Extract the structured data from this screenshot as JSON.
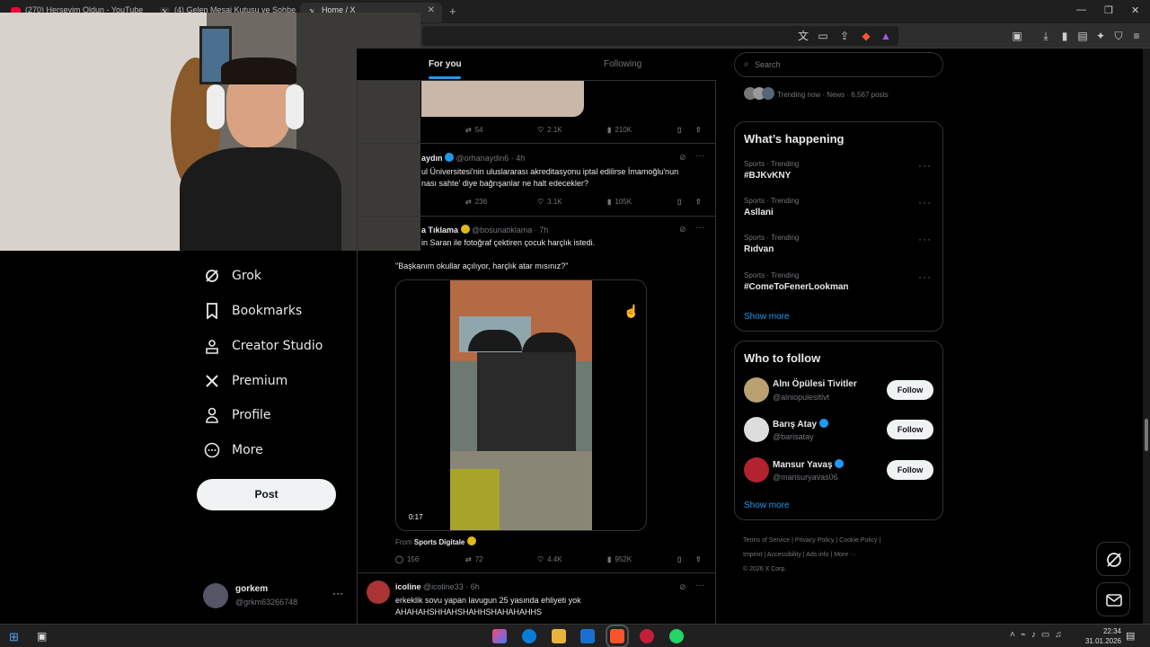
{
  "browser": {
    "tabs": [
      {
        "label": "(270) Herşeyim Oldun - YouTube",
        "active": false,
        "color": "#ff0033"
      },
      {
        "label": "(4) Gelen Mesaj Kutusu ve Sohbe",
        "active": false,
        "color": "#1d9bf0"
      },
      {
        "label": "Home / X",
        "active": true,
        "color": "#ffffff"
      }
    ],
    "new_tab": "+"
  },
  "nav": {
    "items": [
      {
        "label": "Grok",
        "icon": "grok-icon"
      },
      {
        "label": "Bookmarks",
        "icon": "bookmark-icon"
      },
      {
        "label": "Creator Studio",
        "icon": "creator-studio-icon"
      },
      {
        "label": "Premium",
        "icon": "x-logo-icon"
      },
      {
        "label": "Profile",
        "icon": "person-icon"
      },
      {
        "label": "More",
        "icon": "more-circle-icon"
      }
    ],
    "post_label": "Post",
    "account": {
      "name": "gorkem",
      "handle": "@grkm63266748"
    }
  },
  "feed": {
    "tabs": {
      "for_you": "For you",
      "following": "Following"
    },
    "post0_actions": {
      "retweets": "54",
      "likes": "2.1K",
      "views": "210K"
    },
    "post1": {
      "name": "aydın",
      "handle": "@orhanaydin6",
      "time": "· 4h",
      "line1": "ul Üniversitesi'nin uluslararası akreditasyonu iptal edilirse İmamoğlu'nun",
      "line2": "nası sahte' diye bağrışanlar ne halt edecekler?",
      "retweets": "236",
      "likes": "3.1K",
      "views": "105K"
    },
    "post2": {
      "name": "a Tıklama",
      "handle": "@bosunatiklama",
      "time": "· 7h",
      "line1": "in Saran ile fotoğraf çektiren çocuk harçlık istedi.",
      "line2": "\"Başkanım okullar açılıyor, harçlık atar mısınız?\"",
      "video_time": "0:17",
      "from_label": "From",
      "from_name": "Sports Digitale",
      "replies": "156",
      "retweets": "72",
      "likes": "4.4K",
      "views": "952K"
    },
    "post3": {
      "name": "icoline",
      "handle": "@icoline33",
      "time": "· 6h",
      "line1": "erkeklik sovu yapan lavugun 25 yasında ehliyeti yok",
      "line2": "AHAHAHSHHAHSHAHHSHAHAHAHHS"
    }
  },
  "right": {
    "search_placeholder": "Search",
    "top_trend": {
      "meta": "Trending now · News · 6,567 posts"
    },
    "happening_title": "What’s happening",
    "trends": [
      {
        "cat": "Sports · Trending",
        "name": "#BJKvKNY"
      },
      {
        "cat": "Sports · Trending",
        "name": "Asllani"
      },
      {
        "cat": "Sports · Trending",
        "name": "Rıdvan"
      },
      {
        "cat": "Sports · Trending",
        "name": "#ComeToFenerLookman"
      }
    ],
    "show_more": "Show more",
    "who_title": "Who to follow",
    "follow_label": "Follow",
    "suggestions": [
      {
        "name": "Alnı Öpülesi Tivitler",
        "handle": "@alniopulesitivt",
        "verified": false
      },
      {
        "name": "Barış Atay",
        "handle": "@barisatay",
        "verified": true
      },
      {
        "name": "Mansur Yavaş",
        "handle": "@mansuryavas06",
        "verified": true
      }
    ],
    "footer": {
      "row1": [
        "Terms of Service",
        "Privacy Policy",
        "Cookie Policy"
      ],
      "row2": [
        "Imprint",
        "Accessibility",
        "Ads info",
        "More ···"
      ],
      "copyright": "© 2026 X Corp."
    }
  },
  "taskbar": {
    "time": "22:34",
    "date": "31.01.2026"
  }
}
